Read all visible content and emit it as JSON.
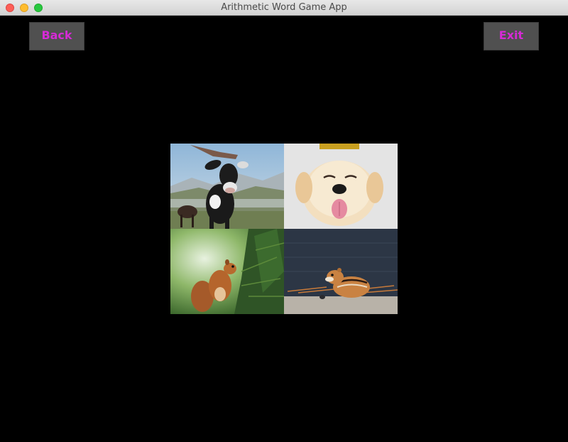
{
  "window": {
    "title": "Arithmetic Word Game App"
  },
  "buttons": {
    "back_label": "Back",
    "exit_label": "Exit"
  },
  "tiles": [
    {
      "animal": "cow"
    },
    {
      "animal": "dog"
    },
    {
      "animal": "squirrel"
    },
    {
      "animal": "chipmunk"
    }
  ],
  "colors": {
    "button_text": "#d62ad6",
    "button_bg": "#505050",
    "background": "#000000"
  }
}
